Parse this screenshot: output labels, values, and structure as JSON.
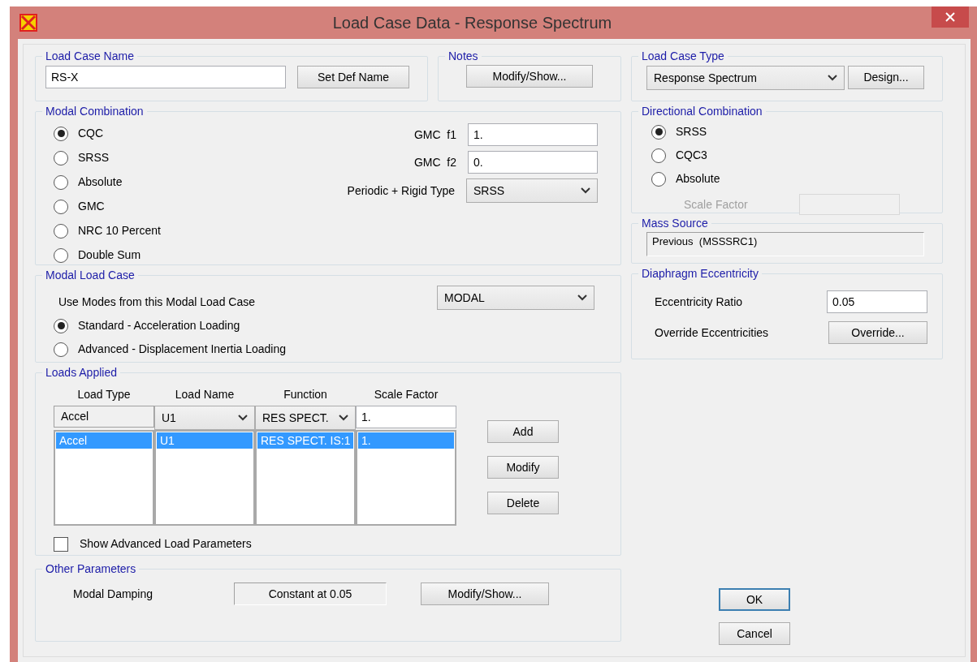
{
  "window": {
    "title": "Load Case Data - Response Spectrum"
  },
  "load_case_name": {
    "title": "Load Case Name",
    "value": "RS-X",
    "button": "Set Def Name"
  },
  "notes": {
    "title": "Notes",
    "button": "Modify/Show..."
  },
  "modal_combination": {
    "title": "Modal Combination",
    "options": [
      {
        "label": "CQC",
        "selected": true
      },
      {
        "label": "SRSS",
        "selected": false
      },
      {
        "label": "Absolute",
        "selected": false
      },
      {
        "label": "GMC",
        "selected": false
      },
      {
        "label": "NRC 10 Percent",
        "selected": false
      },
      {
        "label": "Double Sum",
        "selected": false
      }
    ],
    "fields": [
      {
        "label": "GMC  f1",
        "value": "1."
      },
      {
        "label": "GMC  f2",
        "value": "0."
      }
    ],
    "periodic_rigid": {
      "label": "Periodic + Rigid Type",
      "value": "SRSS"
    }
  },
  "modal_load_case": {
    "title": "Modal Load Case",
    "label": "Use Modes from this Modal Load Case",
    "value": "MODAL",
    "options": [
      {
        "label": "Standard - Acceleration Loading",
        "selected": true
      },
      {
        "label": "Advanced - Displacement Inertia Loading",
        "selected": false
      }
    ]
  },
  "loads_applied": {
    "title": "Loads Applied",
    "columns": [
      "Load Type",
      "Load Name",
      "Function",
      "Scale Factor"
    ],
    "editor": [
      {
        "kind": "text",
        "value": "Accel"
      },
      {
        "kind": "select",
        "value": "U1"
      },
      {
        "kind": "select",
        "value": "RES SPECT."
      },
      {
        "kind": "input",
        "value": "1."
      }
    ],
    "rows": [
      {
        "cells": [
          "Accel",
          "U1",
          "RES SPECT. IS:1",
          "1."
        ],
        "selected": true
      }
    ],
    "buttons": [
      "Add",
      "Modify",
      "Delete"
    ],
    "checkbox": {
      "label": "Show Advanced Load Parameters",
      "checked": false
    }
  },
  "other_parameters": {
    "title": "Other Parameters",
    "label": "Modal Damping",
    "value": "Constant at 0.05",
    "button": "Modify/Show..."
  },
  "load_case_type": {
    "title": "Load Case Type",
    "value": "Response Spectrum",
    "button": "Design..."
  },
  "directional_combination": {
    "title": "Directional Combination",
    "options": [
      {
        "label": "SRSS",
        "selected": true
      },
      {
        "label": "CQC3",
        "selected": false
      },
      {
        "label": "Absolute",
        "selected": false
      }
    ],
    "scale_factor": {
      "label": "Scale Factor",
      "disabled": true
    }
  },
  "mass_source": {
    "title": "Mass Source",
    "value": "Previous  (MSSSRC1)"
  },
  "diaphragm_eccentricity": {
    "title": "Diaphragm Eccentricity",
    "ratio_label": "Eccentricity Ratio",
    "ratio_value": "0.05",
    "override_label": "Override Eccentricities",
    "override_button": "Override..."
  },
  "buttons": [
    {
      "label": "OK",
      "default": true
    },
    {
      "label": "Cancel",
      "default": false
    }
  ]
}
